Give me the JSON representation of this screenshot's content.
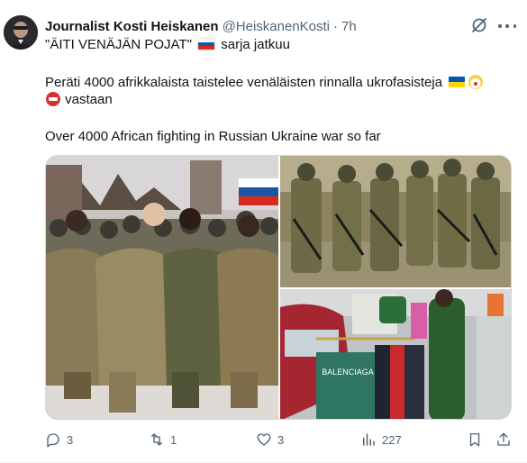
{
  "author": {
    "name": "Journalist Kosti Heiskanen",
    "handle": "@HeiskanenKosti",
    "separator": "·",
    "time": "7h"
  },
  "tweet": {
    "line1_pre": "\"ÄITI VENÄJÄN POJAT\"",
    "line1_post": "sarja jatkuu",
    "line2_pre": "Peräti 4000 afrikkalaista taistelee venäläisten rinnalla ukrofasisteja",
    "line3_post": "vastaan",
    "line4": "Over 4000 African fighting in Russian Ukraine war so far"
  },
  "media": {
    "shirt_text": "BALENCIAGA"
  },
  "actions": {
    "replies": "3",
    "reposts": "1",
    "likes": "3",
    "views": "227"
  },
  "icons": {
    "reply": "reply-icon",
    "repost": "repost-icon",
    "like": "heart-icon",
    "views": "views-icon",
    "bookmark": "bookmark-icon",
    "share": "share-icon",
    "grok": "grok-icon",
    "more": "more-icon"
  },
  "colors": {
    "text": "#0f1419",
    "secondary": "#536471",
    "border": "#cfd9de"
  }
}
